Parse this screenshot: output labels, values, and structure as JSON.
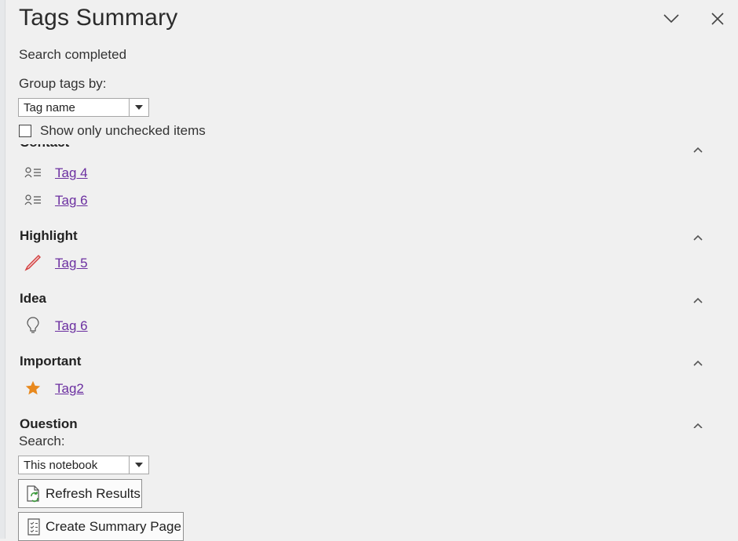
{
  "pane": {
    "title": "Tags Summary",
    "status": "Search completed"
  },
  "group_by": {
    "label": "Group tags by:",
    "value": "Tag name"
  },
  "filter": {
    "show_unchecked_label": "Show only unchecked items",
    "checked": false
  },
  "groups": [
    {
      "name": "Contact",
      "icon": "contact-card-icon",
      "tags": [
        "Tag 4",
        "Tag 6"
      ]
    },
    {
      "name": "Highlight",
      "icon": "highlighter-pen-icon",
      "tags": [
        "Tag 5"
      ]
    },
    {
      "name": "Idea",
      "icon": "lightbulb-icon",
      "tags": [
        "Tag 6"
      ]
    },
    {
      "name": "Important",
      "icon": "star-icon",
      "tags": [
        "Tag2"
      ]
    },
    {
      "name": "Question",
      "icon": "question-icon",
      "tags": []
    }
  ],
  "search": {
    "label": "Search:",
    "value": "This notebook"
  },
  "buttons": {
    "refresh": "Refresh Results",
    "create_summary": "Create Summary Page"
  },
  "colors": {
    "link": "#6b2fa0",
    "star": "#e8891e",
    "highlighter": "#d23f3f",
    "refresh_arrow": "#3a9a3a"
  }
}
